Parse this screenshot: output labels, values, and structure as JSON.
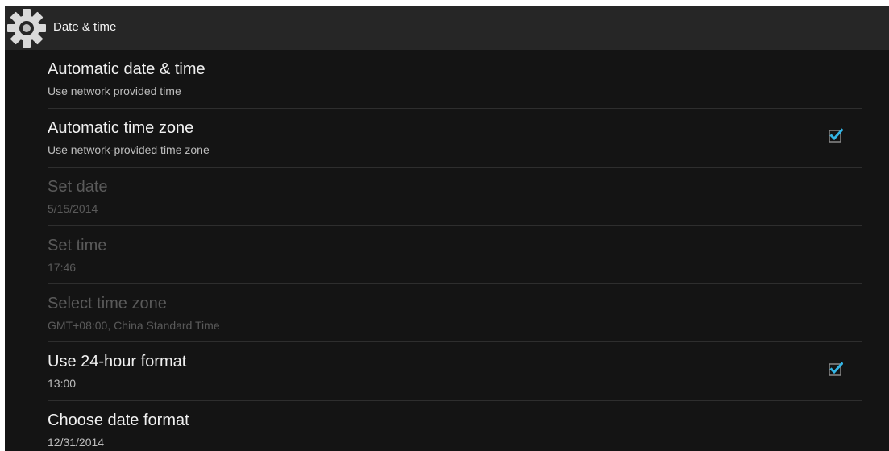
{
  "action_bar": {
    "title": "Date & time",
    "icon": "settings-gear-icon"
  },
  "settings": [
    {
      "id": "automatic-date-time",
      "title": "Automatic date & time",
      "summary": "Use network provided time",
      "enabled": true,
      "has_checkbox": false
    },
    {
      "id": "automatic-time-zone",
      "title": "Automatic time zone",
      "summary": "Use network-provided time zone",
      "enabled": true,
      "has_checkbox": true,
      "checked": true
    },
    {
      "id": "set-date",
      "title": "Set date",
      "summary": "5/15/2014",
      "enabled": false,
      "has_checkbox": false
    },
    {
      "id": "set-time",
      "title": "Set time",
      "summary": "17:46",
      "enabled": false,
      "has_checkbox": false
    },
    {
      "id": "select-time-zone",
      "title": "Select time zone",
      "summary": "GMT+08:00, China Standard Time",
      "enabled": false,
      "has_checkbox": false
    },
    {
      "id": "use-24-hour-format",
      "title": "Use 24-hour format",
      "summary": "13:00",
      "enabled": true,
      "has_checkbox": true,
      "checked": true
    },
    {
      "id": "choose-date-format",
      "title": "Choose date format",
      "summary": "12/31/2014",
      "enabled": true,
      "has_checkbox": false
    }
  ],
  "colors": {
    "accent": "#33b5e5",
    "background": "#141414",
    "action_bar": "#262626"
  }
}
